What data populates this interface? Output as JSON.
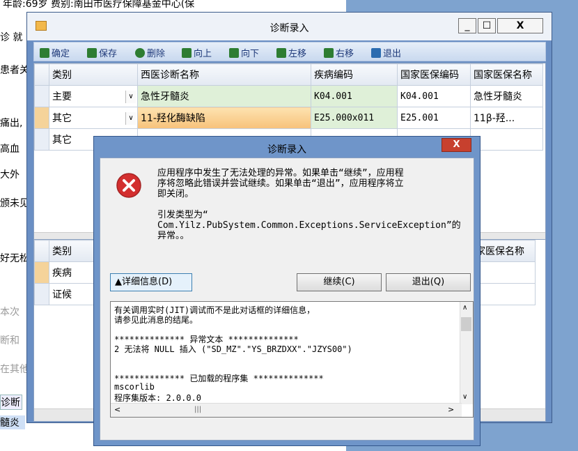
{
  "background": {
    "top_text": "年龄:69岁    费别:南田市医疗保障基金中心(保",
    "left_fragments": [
      "诊 就",
      "患者关",
      "痛出,",
      "高血",
      "大外",
      "颁未见",
      "好无松",
      "本次",
      "断和",
      "在其他",
      "诊断",
      "髓炎"
    ]
  },
  "main_window": {
    "title": "诊断录入",
    "controls": {
      "minimize": "_",
      "maximize": "☐",
      "close": "X"
    },
    "toolbar": [
      {
        "label": "确定",
        "icon": "check-icon",
        "color": "#2e7d32"
      },
      {
        "label": "保存",
        "icon": "save-icon",
        "color": "#2e7d32"
      },
      {
        "label": "删除",
        "icon": "delete-icon",
        "color": "#2e7d32"
      },
      {
        "label": "向上",
        "icon": "arrow-up-icon",
        "color": "#2e7d32"
      },
      {
        "label": "向下",
        "icon": "arrow-down-icon",
        "color": "#2e7d32"
      },
      {
        "label": "左移",
        "icon": "arrow-left-icon",
        "color": "#2e7d32"
      },
      {
        "label": "右移",
        "icon": "arrow-right-icon",
        "color": "#2e7d32"
      },
      {
        "label": "退出",
        "icon": "exit-icon",
        "color": "#2b6cb0"
      }
    ],
    "grid1": {
      "columns": [
        "类别",
        "西医诊断名称",
        "疾病编码",
        "国家医保编码",
        "国家医保名称"
      ],
      "rows": [
        [
          "主要",
          "急性牙髓炎",
          "K04.001",
          "K04.001",
          "急性牙髓炎"
        ],
        [
          "其它",
          "11-羟化酶缺陷",
          "E25.000x011",
          "E25.001",
          "11β-羟..."
        ],
        [
          "其它",
          "",
          "",
          "",
          ""
        ]
      ]
    },
    "grid2": {
      "columns": [
        "类别",
        "国家医保名称"
      ],
      "rows": [
        [
          "疾病"
        ],
        [
          "证候"
        ]
      ]
    }
  },
  "dialog": {
    "title": "诊断录入",
    "close": "X",
    "message_lines": [
      "应用程序中发生了无法处理的异常。如果单击“继续”，应用程",
      "序将忽略此错误并尝试继续。如果单击“退出”，应用程序将立",
      "即关闭。",
      "",
      "引发类型为“",
      "Com.Yilz.PubSystem.Common.Exceptions.ServiceException”的",
      "异常。。"
    ],
    "details_button": "▲详细信息(D)",
    "continue_button": "继续(C)",
    "quit_button": "退出(Q)",
    "details_lines": [
      "有关调用实时(JIT)调试而不是此对话框的详细信息，",
      "请参见此消息的结尾。",
      "",
      "************** 异常文本 **************",
      "2    无法将 NULL 插入 (\"SD_MZ\".\"YS_BRZDXX\".\"JZYS00\")",
      "",
      "",
      "************** 已加载的程序集 **************",
      "mscorlib",
      "    程序集版本: 2.0.0.0"
    ]
  }
}
